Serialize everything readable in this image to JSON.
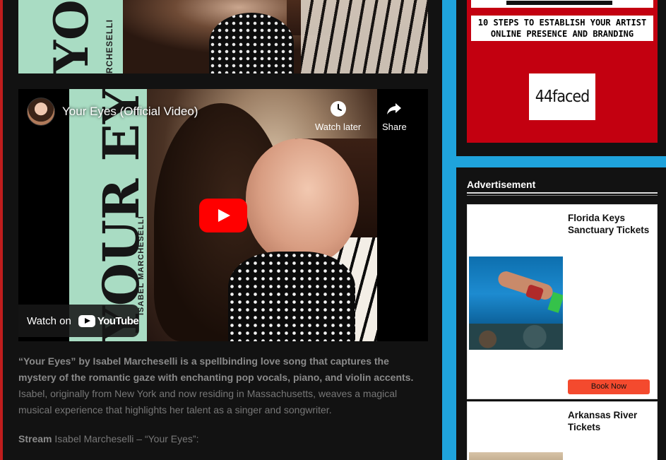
{
  "top_image": {
    "cover_title": "YOUR",
    "cover_artist": "RCHESELLI"
  },
  "video": {
    "title": "Your Eyes (Official Video)",
    "watch_later": "Watch later",
    "share": "Share",
    "watch_on": "Watch on",
    "youtube": "YouTube",
    "cover_title": "YOUR EYES",
    "cover_artist": "ISABEL MARCHESELLI"
  },
  "article": {
    "intro_bold": "“Your Eyes” by Isabel Marcheselli is a spellbinding love song that captures the mystery of the romantic gaze with enchanting pop vocals, piano, and violin accents.",
    "intro_rest": " Isabel, originally from New York and now residing in Massachusetts, weaves a magical musical experience that highlights her talent as a singer and songwriter.",
    "stream_label": "Stream",
    "stream_rest": " Isabel Marcheselli – “Your Eyes”:"
  },
  "promo": {
    "headline_line1": "10 STEPS TO ESTABLISH YOUR ARTIST",
    "headline_line2": "ONLINE PRESENCE AND BRANDING",
    "brand": "44faced"
  },
  "sidebar": {
    "ad_heading": "Advertisement",
    "ads": [
      {
        "name": "Florida Keys Sanctuary Tickets",
        "button": "Book Now"
      },
      {
        "name": "Arkansas River Tickets"
      }
    ]
  },
  "colors": {
    "page_bg": "#1fa3dc",
    "main_bg": "#121212",
    "promo_red": "#c30010",
    "book_button": "#f44a2e",
    "youtube_red": "#ff0000"
  }
}
